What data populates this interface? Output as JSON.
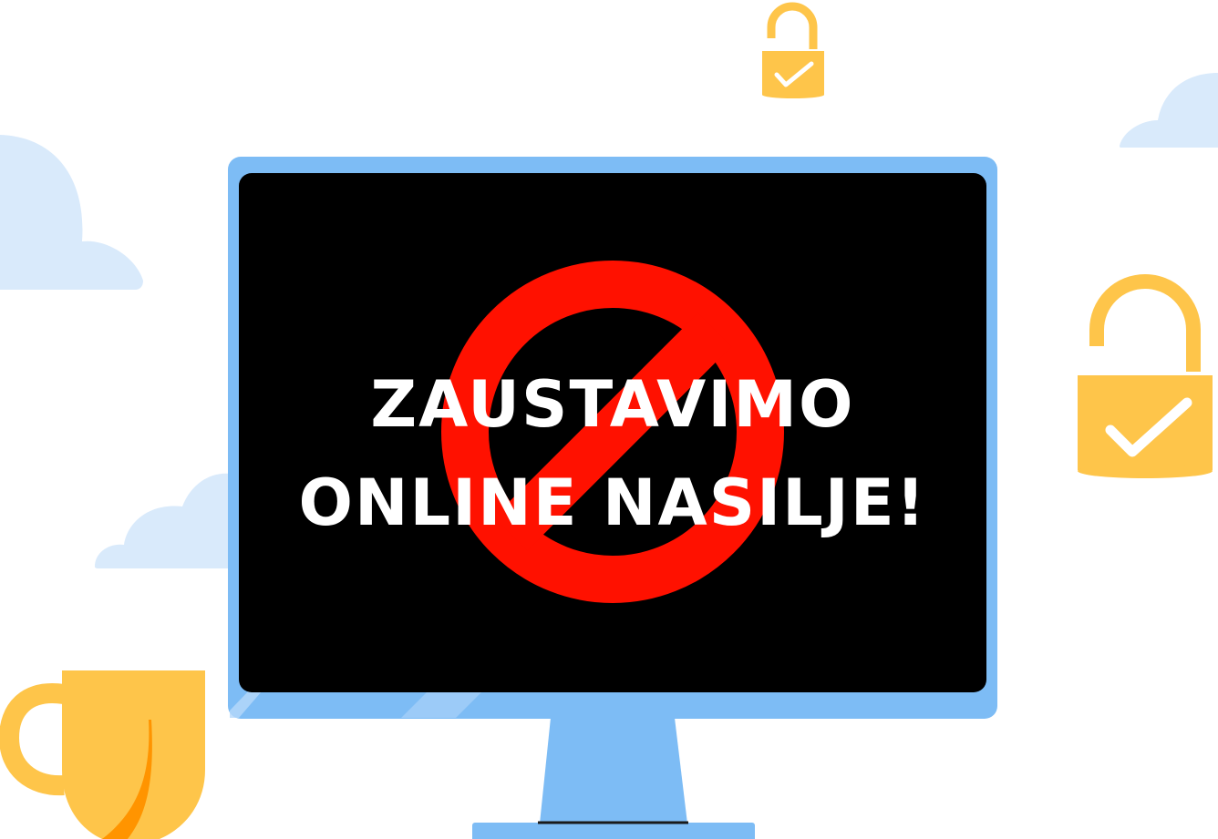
{
  "headline": {
    "line1": "ZAUSTAVIMO",
    "line2": "ONLINE NASILJE!"
  },
  "icons": {
    "prohibition": "prohibition-icon",
    "lock_small": "unlocked-padlock-check-icon",
    "lock_large": "unlocked-padlock-check-icon",
    "mug": "mug-icon",
    "cloud": "cloud-icon",
    "monitor": "monitor-icon"
  },
  "colors": {
    "background": "#ffffff",
    "monitor_frame": "#7dbcf5",
    "screen": "#000000",
    "prohibition_red": "#ff1100",
    "lock_yellow": "#fec54a",
    "cloud_blue": "#d9eafb",
    "mug_orange": "#ff9400",
    "headline_text": "#ffffff"
  }
}
